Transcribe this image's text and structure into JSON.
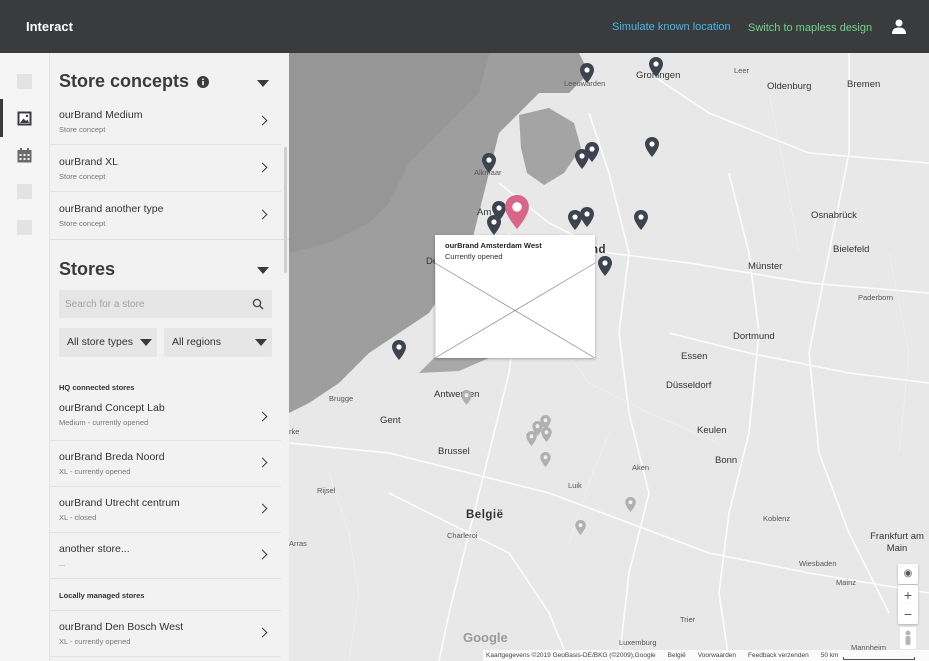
{
  "header": {
    "brand": "Interact",
    "simulate_link": "Simulate known location",
    "mapless_link": "Switch to mapless design",
    "colors": {
      "bar": "#3a3b3d",
      "simulate": "#45b7e8",
      "mapless": "#6fd48a"
    }
  },
  "rail": {
    "items": [
      "square",
      "image-icon",
      "calendar-icon",
      "square",
      "square"
    ],
    "active_index": 1
  },
  "store_concepts": {
    "title": "Store concepts",
    "items": [
      {
        "name": "ourBrand Medium",
        "sub": "Store concept"
      },
      {
        "name": "ourBrand XL",
        "sub": "Store concept"
      },
      {
        "name": "ourBrand another type",
        "sub": "Store concept"
      }
    ]
  },
  "stores": {
    "title": "Stores",
    "search_placeholder": "Search for a store",
    "filter_types": "All store types",
    "filter_regions": "All regions",
    "hq_label": "HQ connected stores",
    "hq_items": [
      {
        "name": "ourBrand Concept Lab",
        "sub": "Medium - currently opened"
      },
      {
        "name": "ourBrand Breda Noord",
        "sub": "XL - currently opened"
      },
      {
        "name": "ourBrand Utrecht centrum",
        "sub": "XL - closed"
      },
      {
        "name": "another store...",
        "sub": "..."
      }
    ],
    "local_label": "Locally managed stores",
    "local_items": [
      {
        "name": "ourBrand Den Bosch West",
        "sub": "XL - currently opened"
      }
    ]
  },
  "map": {
    "popup": {
      "title": "ourBrand Amsterdam West",
      "status": "Currently opened"
    },
    "labels": {
      "groningen": "Groningen",
      "leeuwarden": "Leeuwarden",
      "leer": "Leer",
      "oldenburg": "Oldenburg",
      "bremen": "Bremen",
      "alkmaar": "Alkmaar",
      "amsterdam": "Am",
      "osnabruck": "Osnabrück",
      "bielefeld": "Bielefeld",
      "munster": "Münster",
      "paderborn": "Paderborn",
      "dortmund": "Dortmund",
      "essen": "Essen",
      "dusseldorf": "Düsseldorf",
      "brugge": "Brugge",
      "antwerpen": "Antwerpen",
      "gent": "Gent",
      "brussel": "Brussel",
      "keulen": "Keulen",
      "bonn": "Bonn",
      "aken": "Aken",
      "luik": "Luik",
      "belgie": "België",
      "charleroi": "Charleroi",
      "koblenz": "Koblenz",
      "frankfurt": "Frankfurt am Main",
      "wiesbaden": "Wiesbaden",
      "mainz": "Mainz",
      "trier": "Trier",
      "luxemburg": "Luxemburg",
      "mannheim": "Mannheim",
      "rijsel": "Rijsel",
      "arras": "Arras",
      "nederland_frag": "nd",
      "de_frag": "De",
      "kre": "rke"
    },
    "google": "Google",
    "attribution": [
      "Kaartgegevens ©2019 GeoBasis-DE/BKG (©2009),Google",
      "België",
      "Voorwaarden",
      "Feedback verzenden",
      "50 km"
    ],
    "controls": {
      "locate": "◉",
      "zoom_in": "+",
      "zoom_out": "−"
    },
    "colors": {
      "pin_dark": "#3d4450",
      "pin_active": "#d9658a",
      "pin_faded": "#b0b0b0"
    }
  }
}
